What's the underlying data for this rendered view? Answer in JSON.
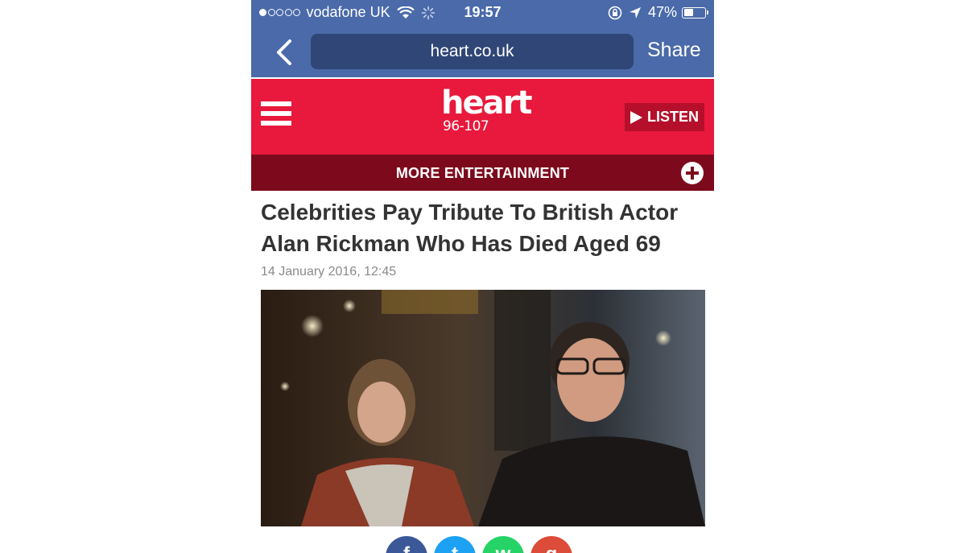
{
  "status_bar": {
    "carrier": "vodafone UK",
    "time": "19:57",
    "battery": "47%",
    "battery_level": 0.47
  },
  "browser": {
    "url": "heart.co.uk",
    "share_label": "Share"
  },
  "header": {
    "brand": "heart",
    "frequency": "96-107",
    "listen_label": "LISTEN",
    "colors": {
      "primary": "#e8193c",
      "dark": "#7c0a1c",
      "chrome": "#4a6aa9"
    }
  },
  "subnav": {
    "label": "MORE ENTERTAINMENT"
  },
  "article": {
    "headline": "Celebrities Pay Tribute To British Actor Alan Rickman Who Has Died Aged 69",
    "date": "14 January 2016, 12:45"
  },
  "social": [
    "facebook-icon",
    "twitter-icon",
    "whatsapp-icon",
    "google-plus-icon"
  ]
}
